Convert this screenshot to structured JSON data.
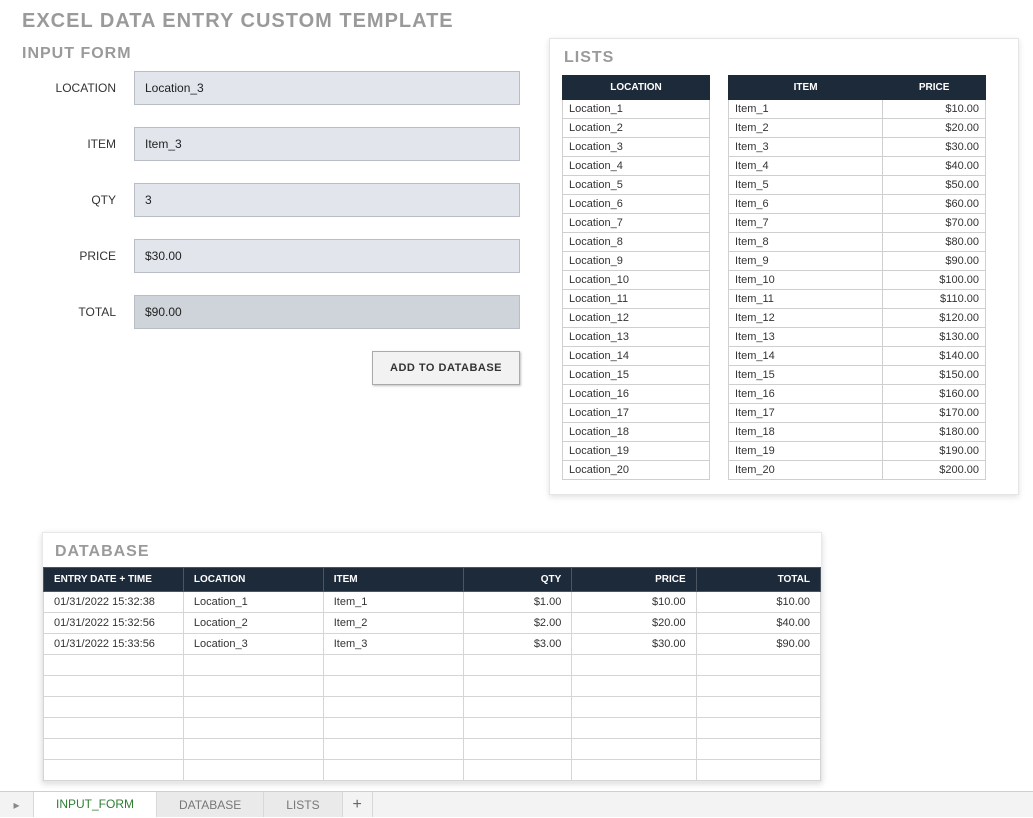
{
  "page_title": "EXCEL DATA ENTRY CUSTOM TEMPLATE",
  "input_form": {
    "title": "INPUT FORM",
    "labels": {
      "location": "LOCATION",
      "item": "ITEM",
      "qty": "QTY",
      "price": "PRICE",
      "total": "TOTAL"
    },
    "values": {
      "location": "Location_3",
      "item": "Item_3",
      "qty": "3",
      "price": "$30.00",
      "total": "$90.00"
    },
    "add_button": "ADD TO DATABASE"
  },
  "lists": {
    "title": "LISTS",
    "headers": {
      "location": "LOCATION",
      "item": "ITEM",
      "price": "PRICE"
    },
    "locations": [
      "Location_1",
      "Location_2",
      "Location_3",
      "Location_4",
      "Location_5",
      "Location_6",
      "Location_7",
      "Location_8",
      "Location_9",
      "Location_10",
      "Location_11",
      "Location_12",
      "Location_13",
      "Location_14",
      "Location_15",
      "Location_16",
      "Location_17",
      "Location_18",
      "Location_19",
      "Location_20"
    ],
    "items": [
      {
        "name": "Item_1",
        "price": "$10.00"
      },
      {
        "name": "Item_2",
        "price": "$20.00"
      },
      {
        "name": "Item_3",
        "price": "$30.00"
      },
      {
        "name": "Item_4",
        "price": "$40.00"
      },
      {
        "name": "Item_5",
        "price": "$50.00"
      },
      {
        "name": "Item_6",
        "price": "$60.00"
      },
      {
        "name": "Item_7",
        "price": "$70.00"
      },
      {
        "name": "Item_8",
        "price": "$80.00"
      },
      {
        "name": "Item_9",
        "price": "$90.00"
      },
      {
        "name": "Item_10",
        "price": "$100.00"
      },
      {
        "name": "Item_11",
        "price": "$110.00"
      },
      {
        "name": "Item_12",
        "price": "$120.00"
      },
      {
        "name": "Item_13",
        "price": "$130.00"
      },
      {
        "name": "Item_14",
        "price": "$140.00"
      },
      {
        "name": "Item_15",
        "price": "$150.00"
      },
      {
        "name": "Item_16",
        "price": "$160.00"
      },
      {
        "name": "Item_17",
        "price": "$170.00"
      },
      {
        "name": "Item_18",
        "price": "$180.00"
      },
      {
        "name": "Item_19",
        "price": "$190.00"
      },
      {
        "name": "Item_20",
        "price": "$200.00"
      }
    ]
  },
  "database": {
    "title": "DATABASE",
    "headers": {
      "entry": "ENTRY DATE + TIME",
      "location": "LOCATION",
      "item": "ITEM",
      "qty": "QTY",
      "price": "PRICE",
      "total": "TOTAL"
    },
    "rows": [
      {
        "entry": "01/31/2022 15:32:38",
        "location": "Location_1",
        "item": "Item_1",
        "qty": "$1.00",
        "price": "$10.00",
        "total": "$10.00"
      },
      {
        "entry": "01/31/2022 15:32:56",
        "location": "Location_2",
        "item": "Item_2",
        "qty": "$2.00",
        "price": "$20.00",
        "total": "$40.00"
      },
      {
        "entry": "01/31/2022 15:33:56",
        "location": "Location_3",
        "item": "Item_3",
        "qty": "$3.00",
        "price": "$30.00",
        "total": "$90.00"
      }
    ],
    "empty_rows": 6
  },
  "sheet_tabs": {
    "tabs": [
      "INPUT_FORM",
      "DATABASE",
      "LISTS"
    ],
    "active": 0
  }
}
